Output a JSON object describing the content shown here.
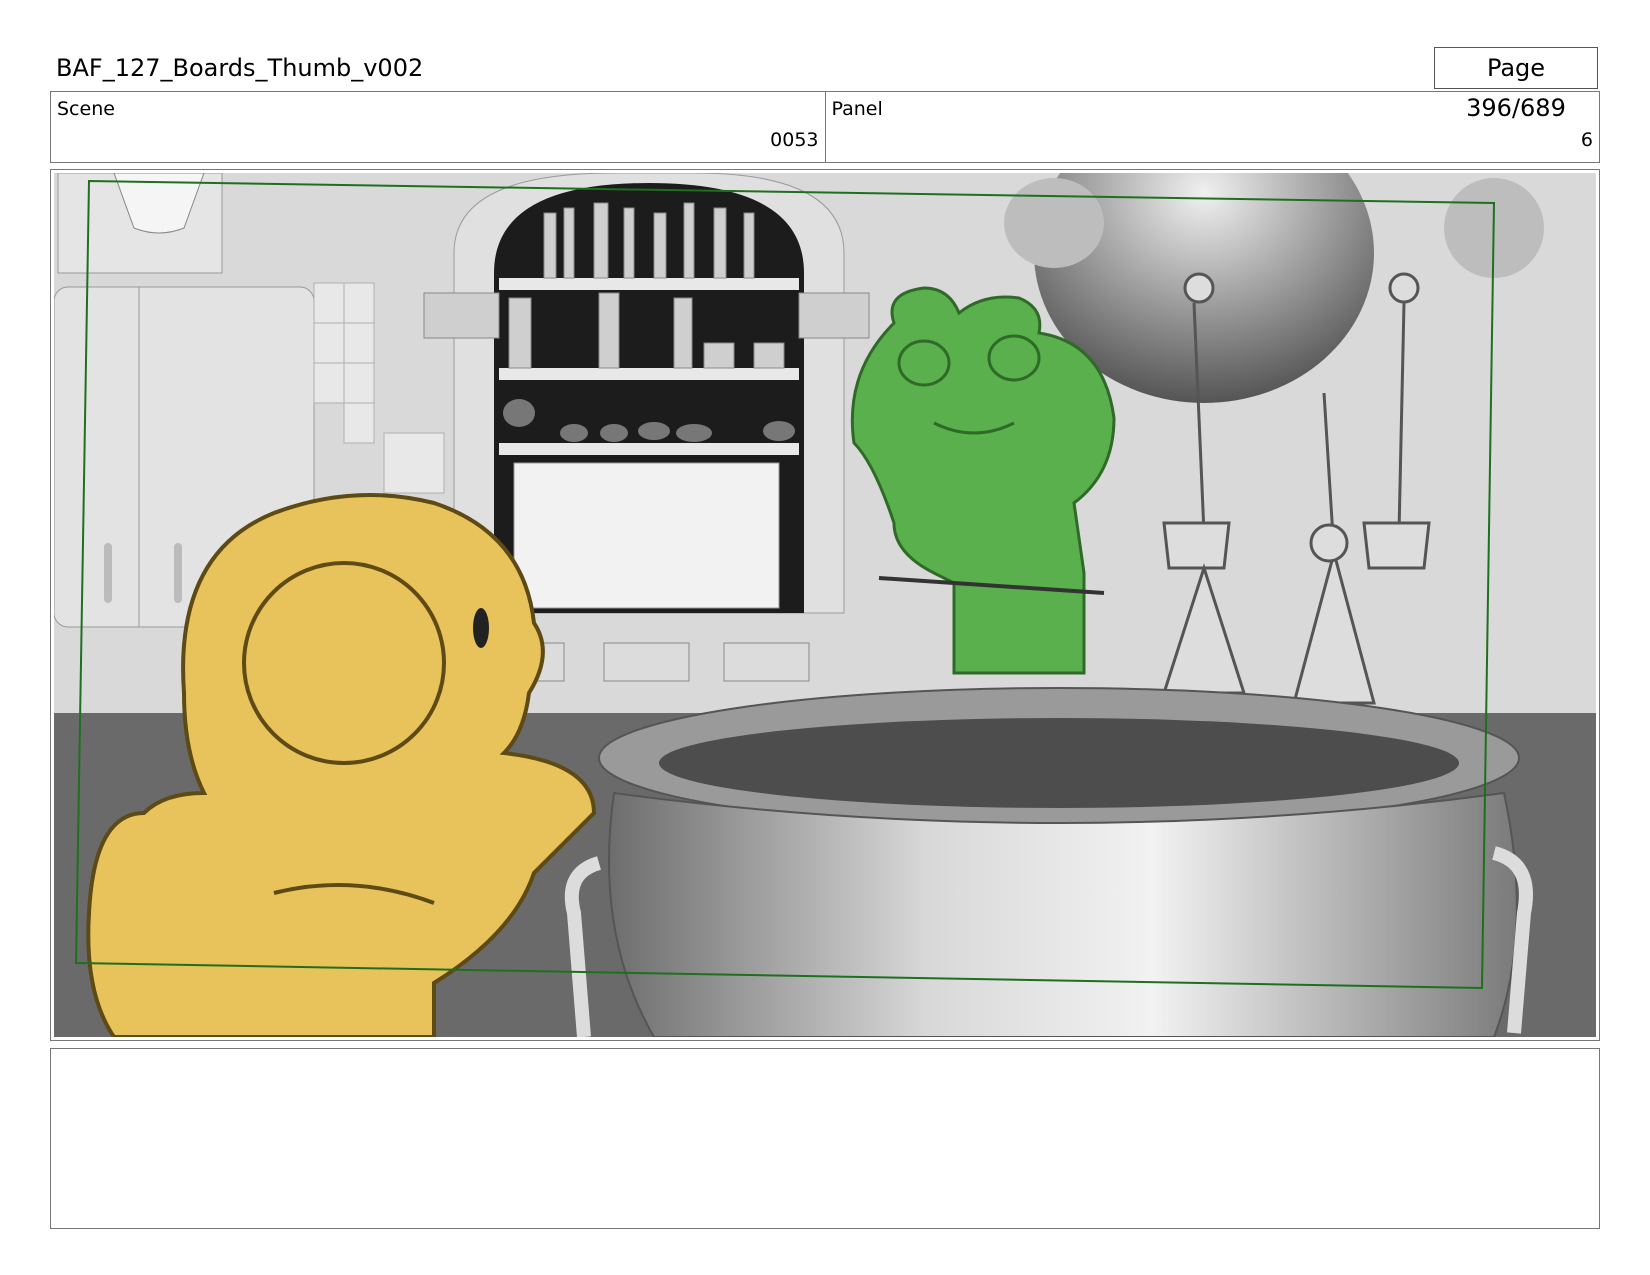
{
  "header": {
    "title": "BAF_127_Boards_Thumb_v002",
    "page": "Page 396/689"
  },
  "info": {
    "scene_label": "Scene",
    "scene_value": "0053",
    "panel_label": "Panel",
    "panel_value": "6"
  },
  "panel_image": {
    "description_colors": {
      "duck": "#e8c25a",
      "frog": "#5ab04c",
      "safe_frame": "#1f6f1f",
      "background": "#d9d9d9"
    }
  },
  "notes": {
    "text": ""
  }
}
